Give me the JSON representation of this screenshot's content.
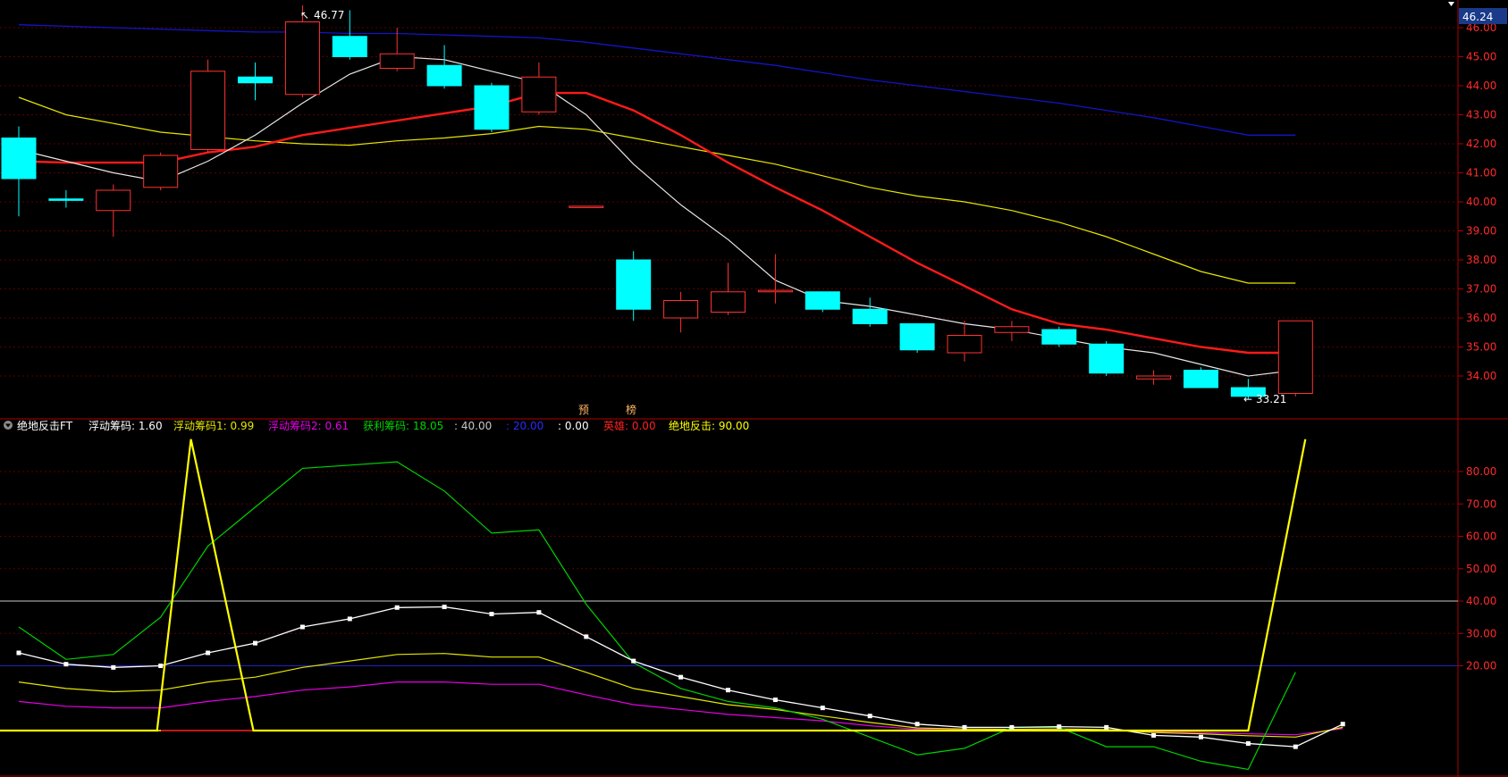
{
  "colors": {
    "background": "#000000",
    "axis_red": "#b00000",
    "grid_red": "#5a0000",
    "candle_up": "#ff3232",
    "candle_down": "#00ffff",
    "ma_white": "#e6e6e6",
    "ma_red": "#ff1a1a",
    "ma_yellow": "#e6e600",
    "ma_blue": "#1414c8",
    "price_box": "#1a3a8a",
    "f1": "#e6e600",
    "f2": "#e600e6",
    "profit": "#00d200",
    "yellow_main": "#ffff00",
    "white_dots": "#ffffff"
  },
  "header": {
    "top_title": "     ",
    "current_price": "46.24"
  },
  "indicator_header": {
    "name": "绝地反击FT",
    "items": [
      {
        "label": "浮动筹码:",
        "value": "1.60",
        "color": "#ffffff"
      },
      {
        "label": "浮动筹码1:",
        "value": "0.99",
        "color": "#e6e600"
      },
      {
        "label": "浮动筹码2:",
        "value": "0.61",
        "color": "#e600e6"
      },
      {
        "label": "获利筹码:",
        "value": "18.05",
        "color": "#00d200"
      },
      {
        "label": ":",
        "value": "40.00",
        "color": "#c8c8c8"
      },
      {
        "label": ":",
        "value": "20.00",
        "color": "#2a2aff"
      },
      {
        "label": ":",
        "value": "0.00",
        "color": "#ffffff"
      },
      {
        "label": "英雄:",
        "value": "0.00",
        "color": "#ff2020"
      },
      {
        "label": "绝地反击:",
        "value": "90.00",
        "color": "#ffff00"
      }
    ]
  },
  "annotations": {
    "high_label": "46.77",
    "low_label": "33.21",
    "marker1": "预",
    "marker2": "榜"
  },
  "price_axis": {
    "ticks": [
      "46.00",
      "45.00",
      "44.00",
      "43.00",
      "42.00",
      "41.00",
      "40.00",
      "39.00",
      "38.00",
      "37.00",
      "36.00",
      "35.00",
      "34.00"
    ]
  },
  "indicator_axis": {
    "ticks": [
      "80.00",
      "70.00",
      "60.00",
      "50.00",
      "40.00",
      "30.00",
      "20.00"
    ]
  },
  "chart_data": [
    {
      "type": "candlestick",
      "ylim": [
        33.21,
        46.77
      ],
      "candles": [
        {
          "o": 42.2,
          "h": 42.6,
          "l": 39.5,
          "c": 40.8
        },
        {
          "o": 40.1,
          "h": 40.4,
          "l": 39.8,
          "c": 40.05
        },
        {
          "o": 39.7,
          "h": 40.6,
          "l": 38.8,
          "c": 40.4
        },
        {
          "o": 40.5,
          "h": 41.7,
          "l": 40.4,
          "c": 41.6
        },
        {
          "o": 41.8,
          "h": 44.9,
          "l": 41.7,
          "c": 44.5
        },
        {
          "o": 44.3,
          "h": 44.8,
          "l": 43.5,
          "c": 44.1
        },
        {
          "o": 43.7,
          "h": 46.77,
          "l": 43.6,
          "c": 46.2
        },
        {
          "o": 45.7,
          "h": 46.6,
          "l": 44.9,
          "c": 45.0
        },
        {
          "o": 44.6,
          "h": 46.0,
          "l": 44.5,
          "c": 45.1
        },
        {
          "o": 44.7,
          "h": 45.4,
          "l": 43.9,
          "c": 44.0
        },
        {
          "o": 44.0,
          "h": 44.1,
          "l": 42.4,
          "c": 42.5
        },
        {
          "o": 43.1,
          "h": 44.8,
          "l": 43.0,
          "c": 44.3
        },
        {
          "o": 39.85,
          "h": 39.85,
          "l": 39.85,
          "c": 39.85
        },
        {
          "o": 38.0,
          "h": 38.3,
          "l": 35.9,
          "c": 36.3
        },
        {
          "o": 36.0,
          "h": 36.9,
          "l": 35.5,
          "c": 36.6
        },
        {
          "o": 36.2,
          "h": 37.9,
          "l": 36.1,
          "c": 36.9
        },
        {
          "o": 36.9,
          "h": 38.2,
          "l": 36.5,
          "c": 36.95
        },
        {
          "o": 36.9,
          "h": 36.9,
          "l": 36.2,
          "c": 36.3
        },
        {
          "o": 36.3,
          "h": 36.7,
          "l": 35.7,
          "c": 35.8
        },
        {
          "o": 35.8,
          "h": 35.8,
          "l": 34.8,
          "c": 34.9
        },
        {
          "o": 34.8,
          "h": 35.9,
          "l": 34.5,
          "c": 35.4
        },
        {
          "o": 35.5,
          "h": 35.9,
          "l": 35.2,
          "c": 35.7
        },
        {
          "o": 35.6,
          "h": 35.7,
          "l": 35.0,
          "c": 35.1
        },
        {
          "o": 35.1,
          "h": 35.2,
          "l": 34.0,
          "c": 34.1
        },
        {
          "o": 33.9,
          "h": 34.2,
          "l": 33.7,
          "c": 34.0
        },
        {
          "o": 34.2,
          "h": 34.3,
          "l": 33.6,
          "c": 33.6
        },
        {
          "o": 33.6,
          "h": 33.9,
          "l": 33.21,
          "c": 33.3
        },
        {
          "o": 33.4,
          "h": 35.9,
          "l": 33.3,
          "c": 35.9
        }
      ],
      "ma_white": [
        41.8,
        41.4,
        41.0,
        40.7,
        41.4,
        42.3,
        43.4,
        44.4,
        45.0,
        44.9,
        44.5,
        44.1,
        43.0,
        41.3,
        39.9,
        38.7,
        37.3,
        36.6,
        36.4,
        36.1,
        35.8,
        35.6,
        35.3,
        35.0,
        34.8,
        34.4,
        34.0,
        34.2
      ],
      "ma_red": [
        41.4,
        41.35,
        41.35,
        41.35,
        41.7,
        41.9,
        42.3,
        42.55,
        42.8,
        43.05,
        43.3,
        43.75,
        43.75,
        43.15,
        42.3,
        41.35,
        40.5,
        39.7,
        38.8,
        37.9,
        37.1,
        36.3,
        35.8,
        35.6,
        35.3,
        35.0,
        34.8,
        34.8
      ],
      "ma_yellow": [
        43.6,
        43.0,
        42.7,
        42.4,
        42.25,
        42.1,
        42.0,
        41.95,
        42.1,
        42.2,
        42.35,
        42.6,
        42.5,
        42.2,
        41.9,
        41.6,
        41.3,
        40.9,
        40.5,
        40.2,
        40.0,
        39.7,
        39.3,
        38.8,
        38.2,
        37.6,
        37.2,
        37.2
      ],
      "ma_blue": [
        46.1,
        46.05,
        46.0,
        45.95,
        45.9,
        45.85,
        45.85,
        45.8,
        45.8,
        45.75,
        45.7,
        45.65,
        45.5,
        45.3,
        45.1,
        44.9,
        44.7,
        44.45,
        44.2,
        44.0,
        43.8,
        43.6,
        43.4,
        43.15,
        42.9,
        42.6,
        42.3,
        42.3
      ]
    },
    {
      "type": "line",
      "title": "绝地反击FT",
      "ylim": [
        -15,
        93
      ],
      "hlines": [
        40,
        20,
        0
      ],
      "series": [
        {
          "name": "浮动筹码",
          "values": [
            24,
            20.5,
            19.5,
            20,
            24,
            27,
            32,
            34.5,
            38,
            38.2,
            36,
            36.5,
            29,
            21.5,
            16.5,
            12.5,
            9.5,
            7,
            4.5,
            2,
            1,
            1,
            1.2,
            1,
            -1.5,
            -2,
            -4,
            -5,
            2
          ]
        },
        {
          "name": "浮动筹码1",
          "values": [
            15,
            13,
            12,
            12.5,
            15,
            16.5,
            19.5,
            21.5,
            23.5,
            23.8,
            22.7,
            22.7,
            18,
            13,
            10.5,
            8,
            6.5,
            4.5,
            2.5,
            0.8,
            0.5,
            0.4,
            0.5,
            0.3,
            -0.6,
            -1,
            -1.6,
            -2,
            0.99
          ]
        },
        {
          "name": "浮动筹码2",
          "values": [
            9,
            7.5,
            7,
            7,
            9,
            10.5,
            12.5,
            13.5,
            15,
            15,
            14.3,
            14.3,
            11,
            8,
            6.5,
            5,
            4,
            3,
            1.5,
            0.4,
            0.2,
            0.2,
            0.2,
            0.1,
            -0.4,
            -0.6,
            -1,
            -1.3,
            0.61
          ]
        },
        {
          "name": "获利筹码",
          "values": [
            32,
            22,
            23.5,
            35,
            57,
            69,
            81,
            82,
            83,
            74,
            61,
            62,
            39,
            21,
            13,
            9,
            7,
            3.5,
            -2,
            -7.5,
            -5.5,
            1,
            1,
            -5,
            -5,
            -9.5,
            -12,
            18.05
          ]
        },
        {
          "name": "绝地反击",
          "values": [
            0,
            0,
            0,
            0,
            90,
            0,
            0,
            0,
            0,
            0,
            0,
            0,
            0,
            0,
            0,
            0,
            0,
            0,
            0,
            0,
            0,
            0,
            0,
            0,
            0,
            0,
            0,
            90
          ]
        }
      ]
    }
  ]
}
